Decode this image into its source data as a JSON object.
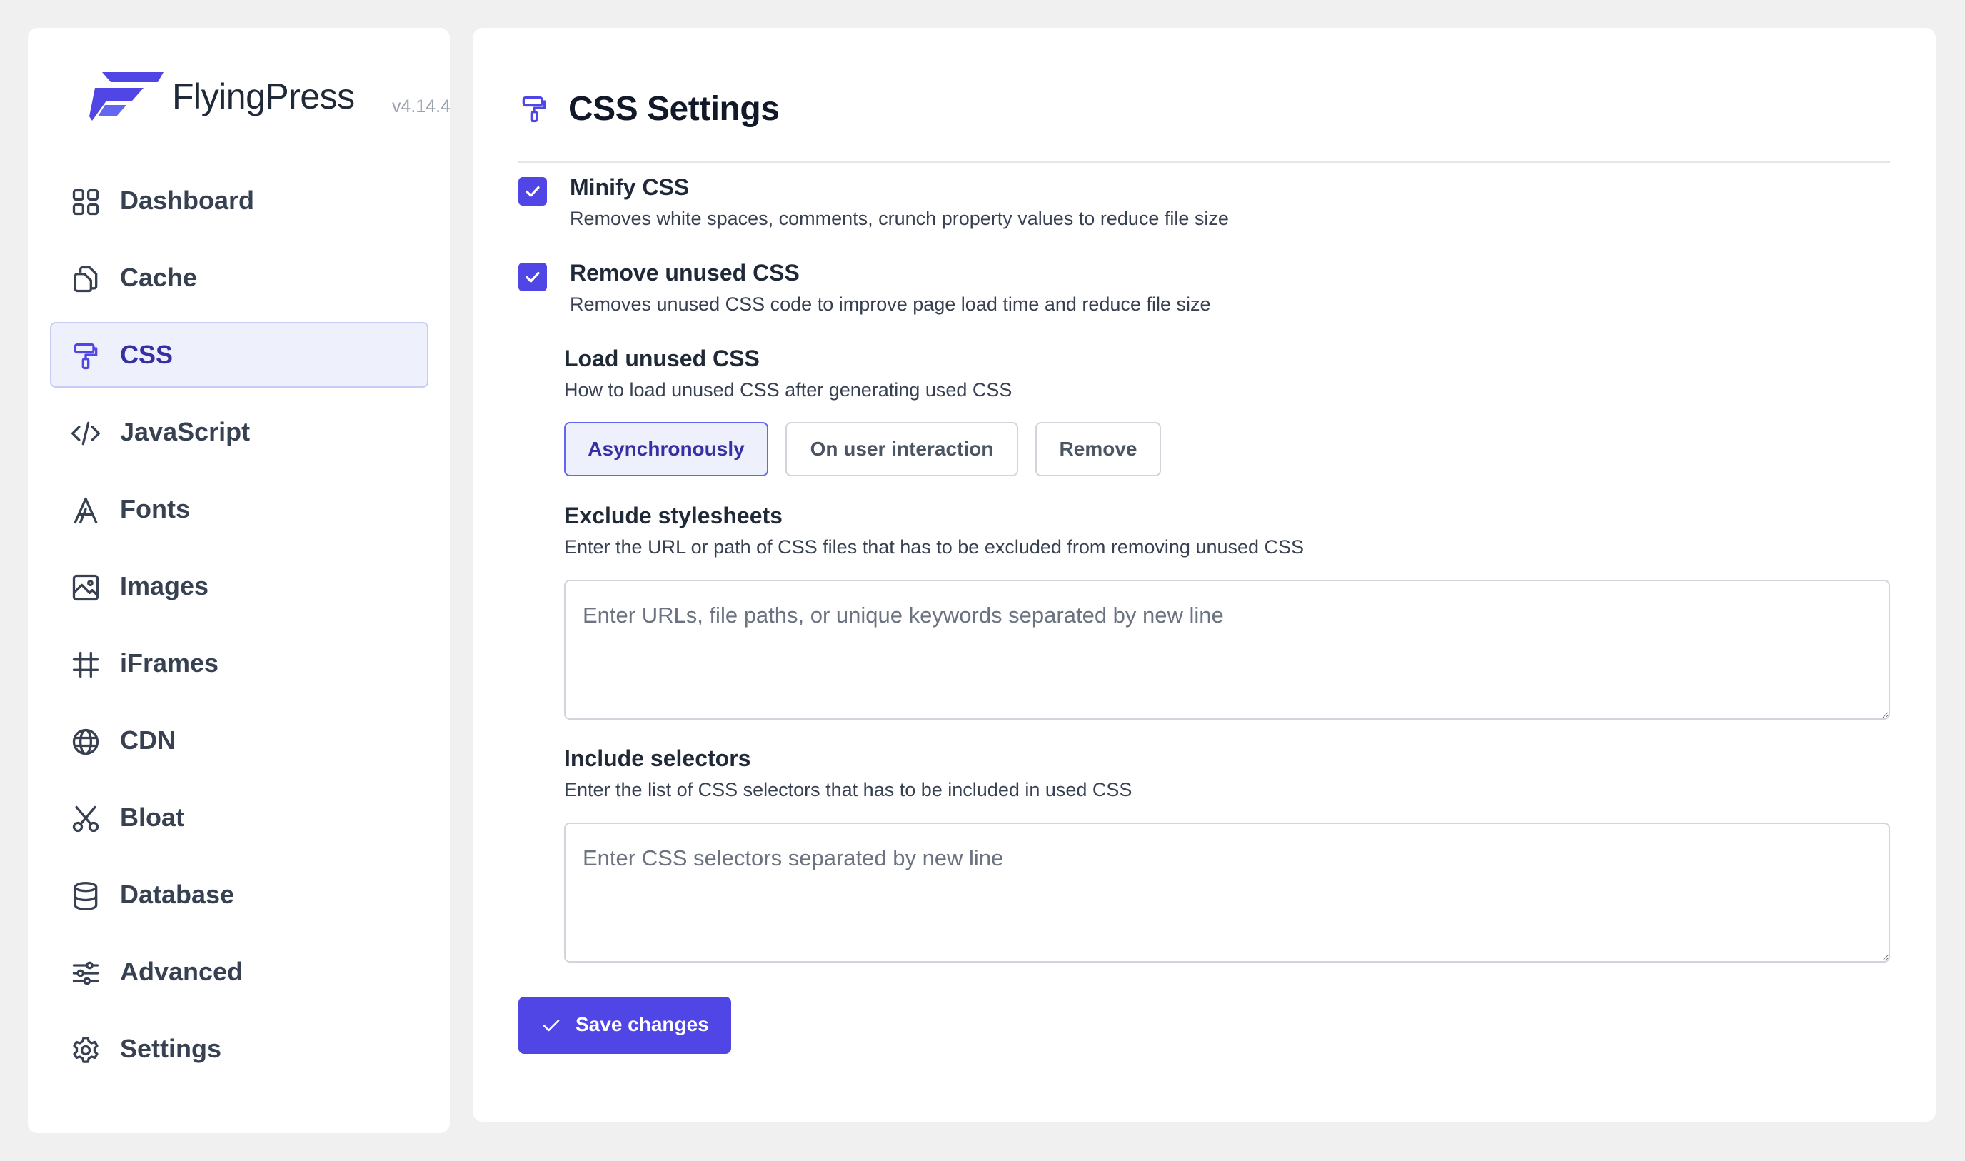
{
  "brand": {
    "name": "FlyingPress",
    "version": "v4.14.4"
  },
  "colors": {
    "accent": "#4f46e5",
    "active_bg": "#eef0fc"
  },
  "sidebar": {
    "items": [
      {
        "label": "Dashboard",
        "icon": "grid-icon",
        "active": false
      },
      {
        "label": "Cache",
        "icon": "copy-icon",
        "active": false
      },
      {
        "label": "CSS",
        "icon": "paint-roller-icon",
        "active": true
      },
      {
        "label": "JavaScript",
        "icon": "code-icon",
        "active": false
      },
      {
        "label": "Fonts",
        "icon": "font-icon",
        "active": false
      },
      {
        "label": "Images",
        "icon": "image-icon",
        "active": false
      },
      {
        "label": "iFrames",
        "icon": "hash-icon",
        "active": false
      },
      {
        "label": "CDN",
        "icon": "globe-icon",
        "active": false
      },
      {
        "label": "Bloat",
        "icon": "scissors-icon",
        "active": false
      },
      {
        "label": "Database",
        "icon": "database-icon",
        "active": false
      },
      {
        "label": "Advanced",
        "icon": "sliders-icon",
        "active": false
      },
      {
        "label": "Settings",
        "icon": "gear-icon",
        "active": false
      }
    ]
  },
  "main": {
    "title": "CSS Settings",
    "minify": {
      "title": "Minify CSS",
      "description": "Removes white spaces, comments, crunch property values to reduce file size",
      "checked": true
    },
    "remove_unused": {
      "title": "Remove unused CSS",
      "description": "Removes unused CSS code to improve page load time and reduce file size",
      "checked": true
    },
    "load_unused": {
      "title": "Load unused CSS",
      "description": "How to load unused CSS after generating used CSS",
      "options": [
        "Asynchronously",
        "On user interaction",
        "Remove"
      ],
      "selected": "Asynchronously"
    },
    "exclude": {
      "title": "Exclude stylesheets",
      "description": "Enter the URL or path of CSS files that has to be excluded from removing unused CSS",
      "placeholder": "Enter URLs, file paths, or unique keywords separated by new line",
      "value": ""
    },
    "include": {
      "title": "Include selectors",
      "description": "Enter the list of CSS selectors that has to be included in used CSS",
      "placeholder": "Enter CSS selectors separated by new line",
      "value": ""
    },
    "save_label": "Save changes"
  }
}
